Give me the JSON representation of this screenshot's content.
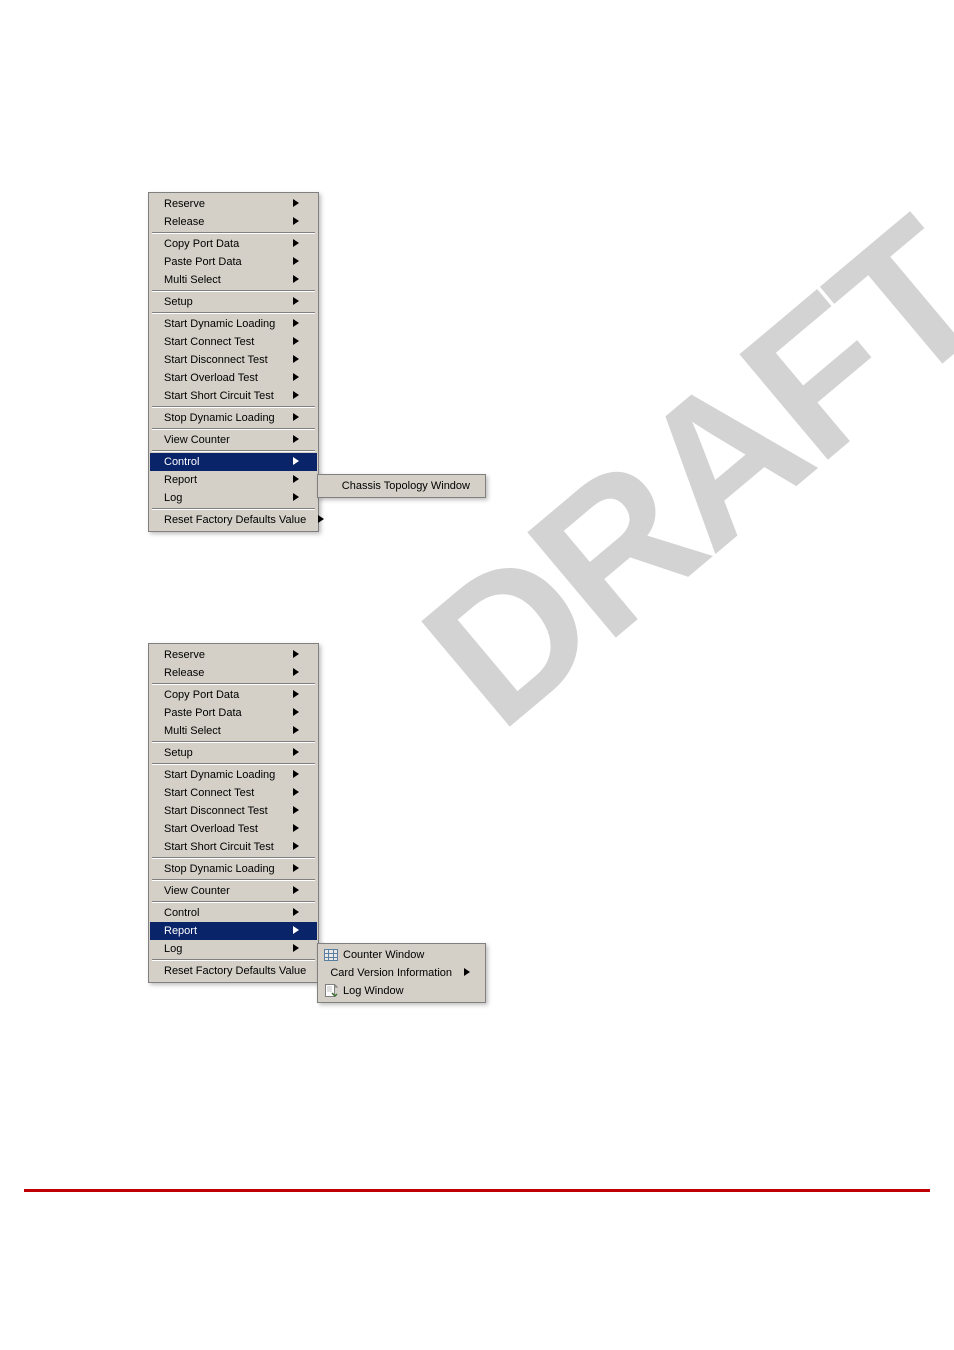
{
  "menu_items": {
    "reserve": "Reserve",
    "release": "Release",
    "copy_port_data": "Copy Port Data",
    "paste_port_data": "Paste Port Data",
    "multi_select": "Multi Select",
    "setup": "Setup",
    "start_dynamic_loading": "Start Dynamic Loading",
    "start_connect_test": "Start Connect Test",
    "start_disconnect_test": "Start Disconnect Test",
    "start_overload_test": "Start Overload Test",
    "start_short_circuit_test": "Start Short Circuit Test",
    "stop_dynamic_loading": "Stop Dynamic Loading",
    "view_counter": "View Counter",
    "control": "Control",
    "report": "Report",
    "log": "Log",
    "reset_factory_defaults": "Reset Factory Defaults Value"
  },
  "submenu1": {
    "chassis_topology_window": "Chassis Topology Window"
  },
  "submenu2": {
    "counter_window": "Counter  Window",
    "card_version_information": "Card Version Information",
    "log_window": "Log Window"
  },
  "watermark": "DRAFT"
}
